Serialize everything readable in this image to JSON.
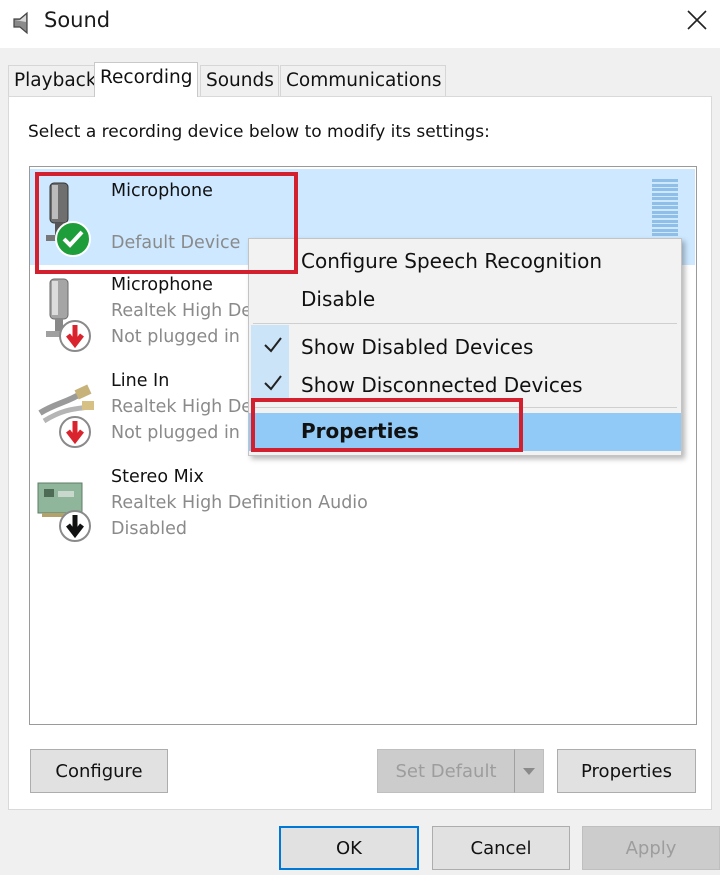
{
  "window": {
    "title": "Sound"
  },
  "tabs": [
    {
      "label": "Playback"
    },
    {
      "label": "Recording"
    },
    {
      "label": "Sounds"
    },
    {
      "label": "Communications"
    }
  ],
  "instruction": "Select a recording device below to modify its settings:",
  "devices": [
    {
      "name": "Microphone",
      "sub1": "",
      "sub2": "Default Device",
      "status": "default",
      "selected": true
    },
    {
      "name": "Microphone",
      "sub1": "Realtek High De",
      "sub2": "Not plugged in",
      "status": "unplugged"
    },
    {
      "name": "Line In",
      "sub1": "Realtek High De",
      "sub2": "Not plugged in",
      "status": "unplugged"
    },
    {
      "name": "Stereo Mix",
      "sub1": "Realtek High Definition Audio",
      "sub2": "Disabled",
      "status": "disabled"
    }
  ],
  "context_menu": {
    "items": [
      {
        "label": "Configure Speech Recognition",
        "checked": false
      },
      {
        "label": "Disable",
        "checked": false
      },
      {
        "label": "Show Disabled Devices",
        "checked": true
      },
      {
        "label": "Show Disconnected Devices",
        "checked": true
      },
      {
        "label": "Properties",
        "checked": false,
        "highlighted": true,
        "bold": true
      }
    ]
  },
  "buttons": {
    "configure": "Configure",
    "set_default": "Set Default",
    "properties": "Properties",
    "ok": "OK",
    "cancel": "Cancel",
    "apply": "Apply"
  },
  "colors": {
    "selection": "#cde8ff",
    "menu_highlight": "#91c9f7",
    "annotation_red": "#d2202e",
    "default_green": "#1e9e3a",
    "unplugged_red": "#d9232d",
    "accent_blue": "#0078d7"
  },
  "icons": {
    "window": "speaker-icon",
    "close": "close-icon",
    "check": "checkmark-icon",
    "dropdown": "chevron-down-icon"
  }
}
